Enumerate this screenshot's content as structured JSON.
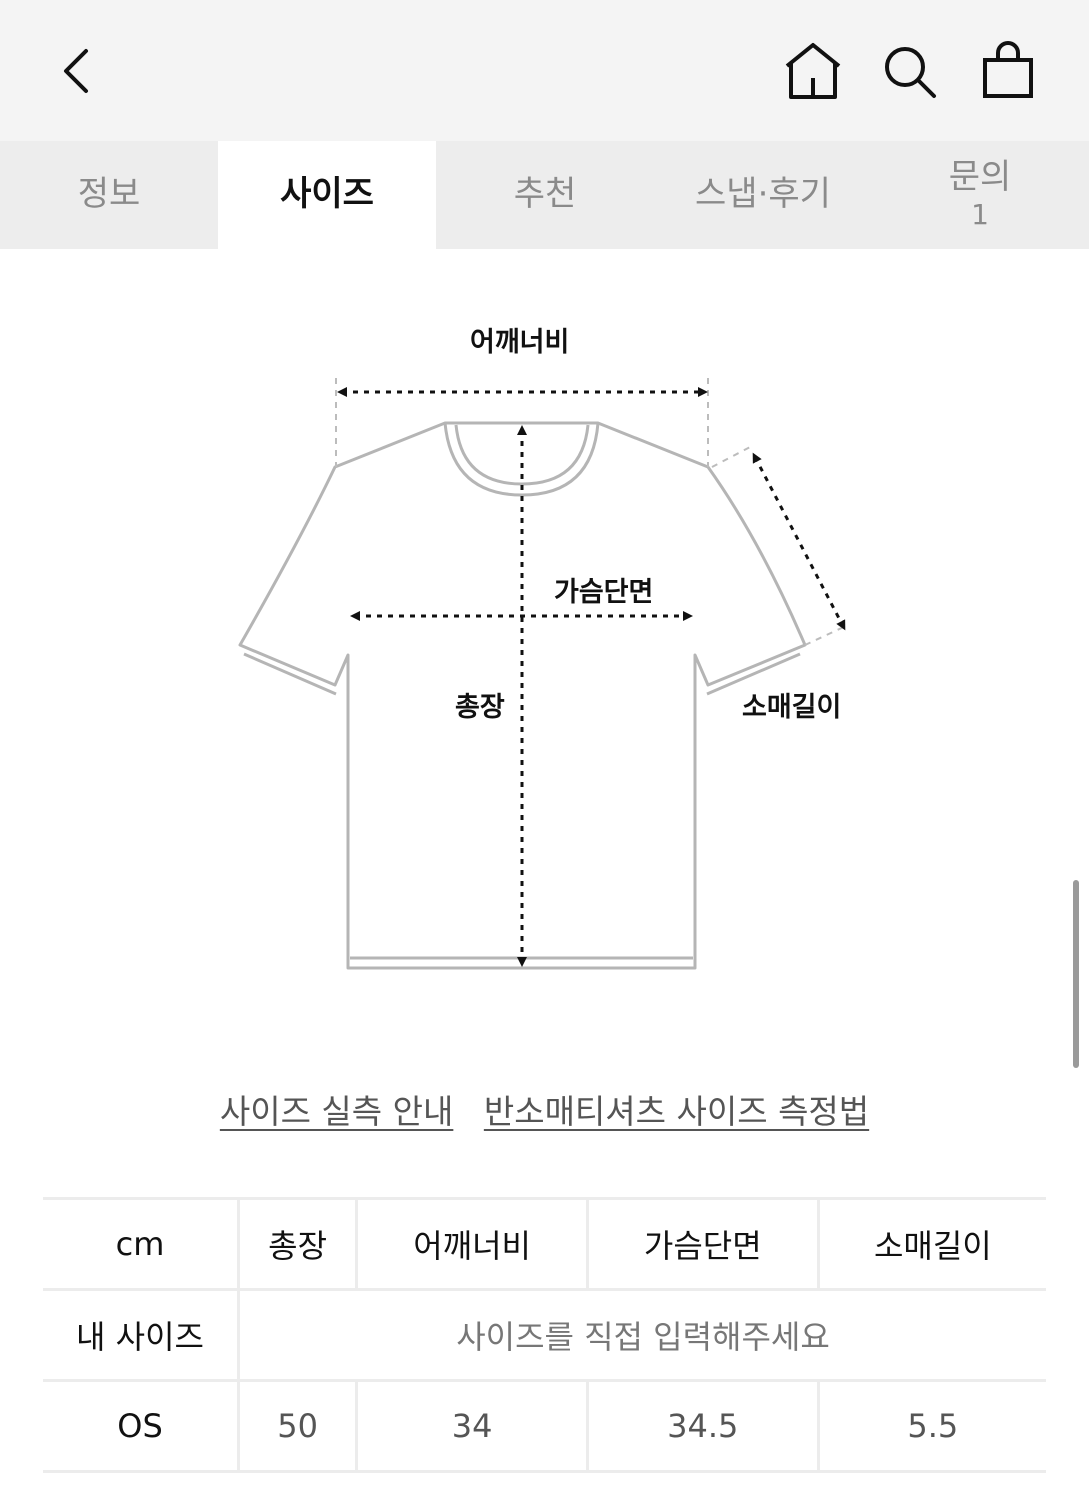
{
  "header": {
    "back_icon": "chevron-left-icon",
    "home_icon": "home-icon",
    "search_icon": "search-icon",
    "bag_icon": "shopping-bag-icon"
  },
  "tabs": [
    {
      "label": "정보",
      "active": false
    },
    {
      "label": "사이즈",
      "active": true
    },
    {
      "label": "추천",
      "active": false
    },
    {
      "label": "스냅·후기",
      "active": false
    },
    {
      "label": "문의",
      "count": "1",
      "active": false
    }
  ],
  "diagram": {
    "shoulder_label": "어깨너비",
    "chest_label": "가슴단면",
    "length_label": "총장",
    "sleeve_label": "소매길이"
  },
  "guides": {
    "link1": "사이즈 실측 안내",
    "link2": "반소매티셔츠 사이즈 측정법"
  },
  "size_table": {
    "unit": "cm",
    "columns": [
      "총장",
      "어깨너비",
      "가슴단면",
      "소매길이"
    ],
    "my_size_label": "내 사이즈",
    "my_size_placeholder": "사이즈를 직접 입력해주세요",
    "rows": [
      {
        "size": "OS",
        "values": [
          "50",
          "34",
          "34.5",
          "5.5"
        ]
      }
    ]
  }
}
